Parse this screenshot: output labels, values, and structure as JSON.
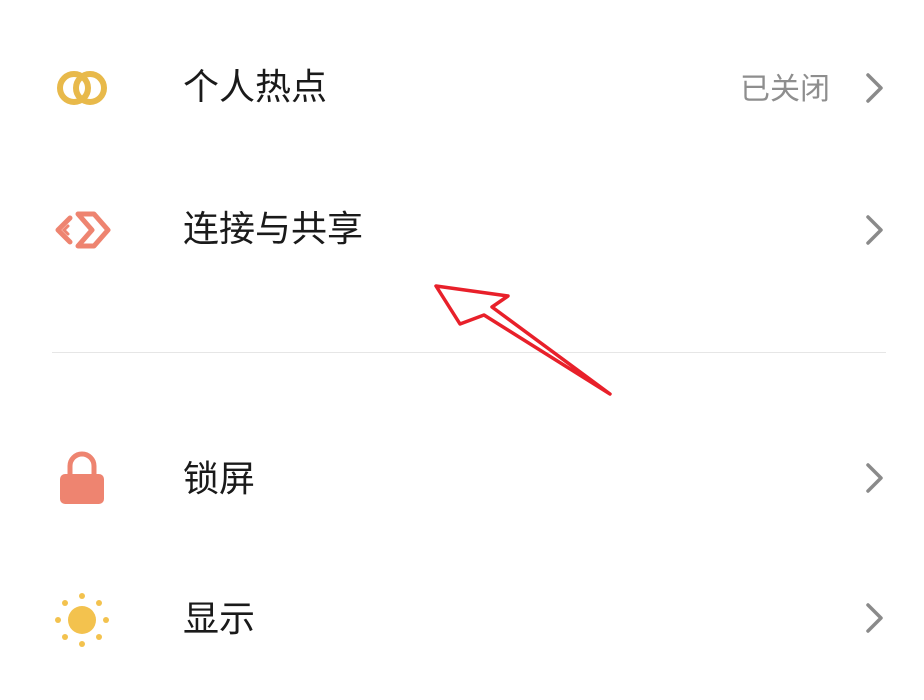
{
  "settings": {
    "items": [
      {
        "label": "个人热点",
        "value": "已关闭",
        "icon": "hotspot-rings-icon",
        "icon_color": "#E8B94A"
      },
      {
        "label": "连接与共享",
        "value": "",
        "icon": "connection-share-icon",
        "icon_color": "#EE8470"
      },
      {
        "label": "锁屏",
        "value": "",
        "icon": "lock-icon",
        "icon_color": "#EE8470"
      },
      {
        "label": "显示",
        "value": "",
        "icon": "sun-icon",
        "icon_color": "#F3C24E"
      }
    ]
  },
  "annotation": {
    "arrow_color": "#E8202A",
    "arrow_target": "连接与共享"
  }
}
